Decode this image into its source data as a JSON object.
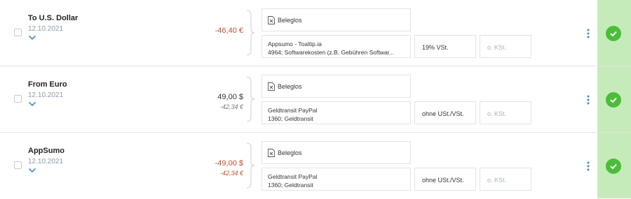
{
  "colors": {
    "negative": "#c0502a",
    "accent": "#3d8bd1",
    "status_bg": "#c6ebba",
    "check": "#4cbd3a"
  },
  "rows": [
    {
      "title": "To U.S. Dollar",
      "date": "12.10.2021",
      "amount": "-46,40 €",
      "amount_secondary": "",
      "receipt": "Beleglos",
      "account_line1": "Appsumo - Toaltip.ia",
      "account_line2": "4964; Softwarekosten (z.B. Gebühren Softwar...",
      "tax": "19% VSt.",
      "cost_center": "o. KSt.",
      "status": "check-icon"
    },
    {
      "title": "From Euro",
      "date": "12.10.2021",
      "amount": "49,00 $",
      "amount_secondary": "-42,34 €",
      "receipt": "Beleglos",
      "account_line1": "Geldtransit PayPal",
      "account_line2": "1360; Geldtransit",
      "tax": "ohne USt./VSt.",
      "cost_center": "o. KSt.",
      "status": "check-icon"
    },
    {
      "title": "AppSumo",
      "date": "12.10.2021",
      "amount": "-49,00 $",
      "amount_secondary": "-42,34 €",
      "receipt": "Beleglos",
      "account_line1": "Geldtransit PayPal",
      "account_line2": "1360; Geldtransit",
      "tax": "ohne USt./VSt.",
      "cost_center": "o. KSt.",
      "status": "check-icon"
    }
  ]
}
